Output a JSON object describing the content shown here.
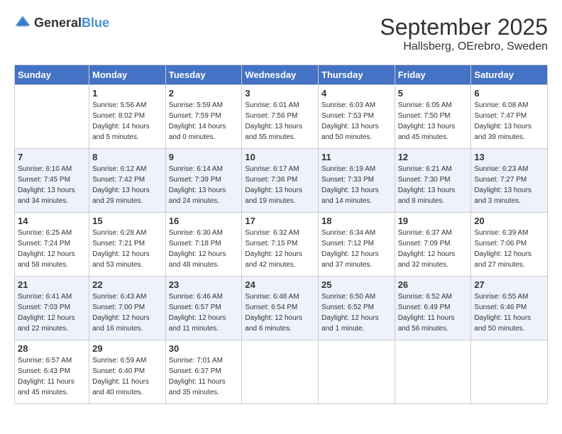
{
  "header": {
    "logo_general": "General",
    "logo_blue": "Blue",
    "month_title": "September 2025",
    "subtitle": "Hallsberg, OErebro, Sweden"
  },
  "columns": [
    "Sunday",
    "Monday",
    "Tuesday",
    "Wednesday",
    "Thursday",
    "Friday",
    "Saturday"
  ],
  "weeks": [
    [
      {
        "day": "",
        "sunrise": "",
        "sunset": "",
        "daylight": ""
      },
      {
        "day": "1",
        "sunrise": "5:56 AM",
        "sunset": "8:02 PM",
        "daylight": "14 hours and 5 minutes."
      },
      {
        "day": "2",
        "sunrise": "5:59 AM",
        "sunset": "7:59 PM",
        "daylight": "14 hours and 0 minutes."
      },
      {
        "day": "3",
        "sunrise": "6:01 AM",
        "sunset": "7:56 PM",
        "daylight": "13 hours and 55 minutes."
      },
      {
        "day": "4",
        "sunrise": "6:03 AM",
        "sunset": "7:53 PM",
        "daylight": "13 hours and 50 minutes."
      },
      {
        "day": "5",
        "sunrise": "6:05 AM",
        "sunset": "7:50 PM",
        "daylight": "13 hours and 45 minutes."
      },
      {
        "day": "6",
        "sunrise": "6:08 AM",
        "sunset": "7:47 PM",
        "daylight": "13 hours and 39 minutes."
      }
    ],
    [
      {
        "day": "7",
        "sunrise": "6:10 AM",
        "sunset": "7:45 PM",
        "daylight": "13 hours and 34 minutes."
      },
      {
        "day": "8",
        "sunrise": "6:12 AM",
        "sunset": "7:42 PM",
        "daylight": "13 hours and 29 minutes."
      },
      {
        "day": "9",
        "sunrise": "6:14 AM",
        "sunset": "7:39 PM",
        "daylight": "13 hours and 24 minutes."
      },
      {
        "day": "10",
        "sunrise": "6:17 AM",
        "sunset": "7:36 PM",
        "daylight": "13 hours and 19 minutes."
      },
      {
        "day": "11",
        "sunrise": "6:19 AM",
        "sunset": "7:33 PM",
        "daylight": "13 hours and 14 minutes."
      },
      {
        "day": "12",
        "sunrise": "6:21 AM",
        "sunset": "7:30 PM",
        "daylight": "13 hours and 8 minutes."
      },
      {
        "day": "13",
        "sunrise": "6:23 AM",
        "sunset": "7:27 PM",
        "daylight": "13 hours and 3 minutes."
      }
    ],
    [
      {
        "day": "14",
        "sunrise": "6:25 AM",
        "sunset": "7:24 PM",
        "daylight": "12 hours and 58 minutes."
      },
      {
        "day": "15",
        "sunrise": "6:28 AM",
        "sunset": "7:21 PM",
        "daylight": "12 hours and 53 minutes."
      },
      {
        "day": "16",
        "sunrise": "6:30 AM",
        "sunset": "7:18 PM",
        "daylight": "12 hours and 48 minutes."
      },
      {
        "day": "17",
        "sunrise": "6:32 AM",
        "sunset": "7:15 PM",
        "daylight": "12 hours and 42 minutes."
      },
      {
        "day": "18",
        "sunrise": "6:34 AM",
        "sunset": "7:12 PM",
        "daylight": "12 hours and 37 minutes."
      },
      {
        "day": "19",
        "sunrise": "6:37 AM",
        "sunset": "7:09 PM",
        "daylight": "12 hours and 32 minutes."
      },
      {
        "day": "20",
        "sunrise": "6:39 AM",
        "sunset": "7:06 PM",
        "daylight": "12 hours and 27 minutes."
      }
    ],
    [
      {
        "day": "21",
        "sunrise": "6:41 AM",
        "sunset": "7:03 PM",
        "daylight": "12 hours and 22 minutes."
      },
      {
        "day": "22",
        "sunrise": "6:43 AM",
        "sunset": "7:00 PM",
        "daylight": "12 hours and 16 minutes."
      },
      {
        "day": "23",
        "sunrise": "6:46 AM",
        "sunset": "6:57 PM",
        "daylight": "12 hours and 11 minutes."
      },
      {
        "day": "24",
        "sunrise": "6:48 AM",
        "sunset": "6:54 PM",
        "daylight": "12 hours and 6 minutes."
      },
      {
        "day": "25",
        "sunrise": "6:50 AM",
        "sunset": "6:52 PM",
        "daylight": "12 hours and 1 minute."
      },
      {
        "day": "26",
        "sunrise": "6:52 AM",
        "sunset": "6:49 PM",
        "daylight": "11 hours and 56 minutes."
      },
      {
        "day": "27",
        "sunrise": "6:55 AM",
        "sunset": "6:46 PM",
        "daylight": "11 hours and 50 minutes."
      }
    ],
    [
      {
        "day": "28",
        "sunrise": "6:57 AM",
        "sunset": "6:43 PM",
        "daylight": "11 hours and 45 minutes."
      },
      {
        "day": "29",
        "sunrise": "6:59 AM",
        "sunset": "6:40 PM",
        "daylight": "11 hours and 40 minutes."
      },
      {
        "day": "30",
        "sunrise": "7:01 AM",
        "sunset": "6:37 PM",
        "daylight": "11 hours and 35 minutes."
      },
      {
        "day": "",
        "sunrise": "",
        "sunset": "",
        "daylight": ""
      },
      {
        "day": "",
        "sunrise": "",
        "sunset": "",
        "daylight": ""
      },
      {
        "day": "",
        "sunrise": "",
        "sunset": "",
        "daylight": ""
      },
      {
        "day": "",
        "sunrise": "",
        "sunset": "",
        "daylight": ""
      }
    ]
  ]
}
